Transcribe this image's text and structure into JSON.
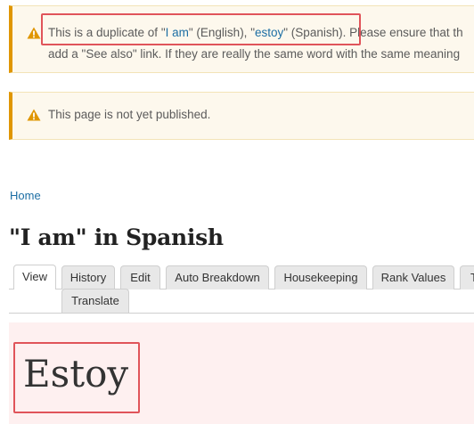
{
  "notices": {
    "duplicate": {
      "prefix": "This is a duplicate of \"",
      "link1": "I am",
      "middle1": "\" (English), \"",
      "link2": "estoy",
      "middle2": "\" (Spanish).",
      "suffix": " Please ensure that th",
      "line2": "add a \"See also\" link. If they are really the same word with the same meaning"
    },
    "unpublished": "This page is not yet published."
  },
  "breadcrumb": {
    "home": "Home"
  },
  "page": {
    "title": "\"I am\" in Spanish"
  },
  "tabs": [
    {
      "label": "View",
      "active": true
    },
    {
      "label": "History"
    },
    {
      "label": "Edit"
    },
    {
      "label": "Auto Breakdown"
    },
    {
      "label": "Housekeeping"
    },
    {
      "label": "Rank Values"
    },
    {
      "label": "T"
    },
    {
      "label": "Translate"
    }
  ],
  "content": {
    "word": "Estoy"
  },
  "colors": {
    "warning": "#e09600",
    "link": "#1c6ea4",
    "highlight": "#e0545a"
  }
}
